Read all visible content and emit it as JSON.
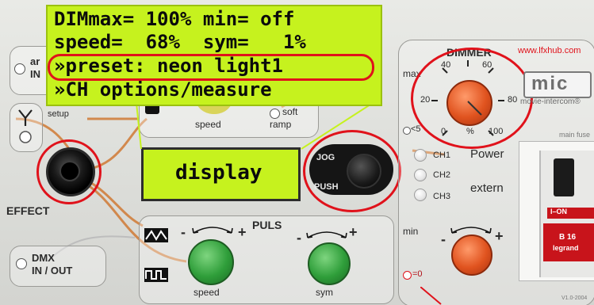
{
  "lcd_popup": {
    "line1": "DIMmax= 100% min= off",
    "line2": "speed=  68%  sym=   1%",
    "line3": "»preset: neon light1",
    "line4": "»CH options/measure"
  },
  "display": {
    "label": "display"
  },
  "left_column": {
    "ar_label": "ar",
    "in_label": "IN",
    "setup_label": "setup",
    "effect_label": "EFFECT",
    "dmx_label_1": "DMX",
    "dmx_label_2": "IN / OUT"
  },
  "top_center": {
    "speed_label": "speed",
    "soft_label": "soft",
    "ramp_label": "ramp"
  },
  "jog": {
    "jog_label": "JOG",
    "push_label": "PUSH"
  },
  "puls": {
    "title": "PULS",
    "speed_label": "speed",
    "sym_label": "sym",
    "minus": "-",
    "plus": "+"
  },
  "dimmer": {
    "title": "DIMMER",
    "max_label": "max",
    "lt5_label": "<5",
    "percent_label": "%",
    "scale": [
      "0",
      "20",
      "40",
      "60",
      "80",
      "100"
    ],
    "min_label": "min",
    "eq0_label": "=0",
    "minus": "-",
    "plus": "+"
  },
  "channels": {
    "ch1": "CH1",
    "ch2": "CH2",
    "ch3": "CH3",
    "power": "Power",
    "extern": "extern"
  },
  "brand": {
    "url": "www.lfxhub.com",
    "logo": "mic",
    "sub": "movie-intercom®",
    "fuse_label": "main fuse",
    "breaker_i": "I–ON",
    "breaker_rating": "B 16",
    "breaker_brand": "legrand",
    "version": "V1.0-2004"
  },
  "colors": {
    "lcd_bg": "#c6f21e",
    "highlight": "#e0121b",
    "knob_green": "#2f9e3a",
    "knob_orange": "#e0531f"
  }
}
